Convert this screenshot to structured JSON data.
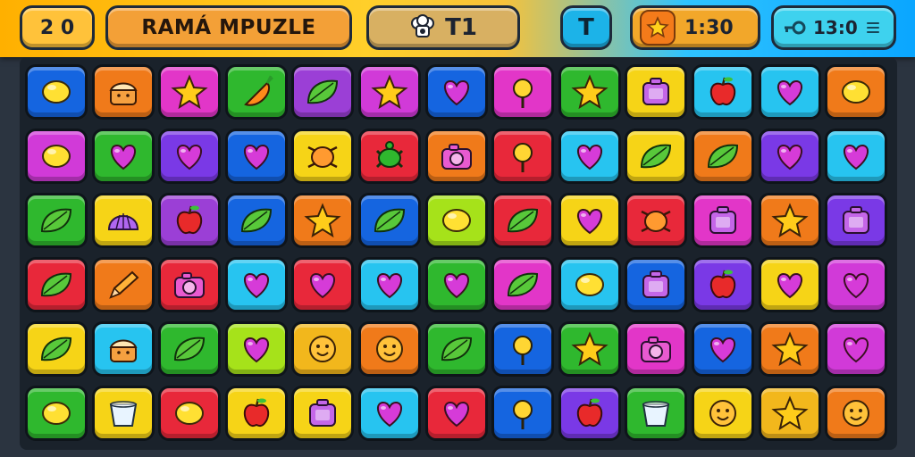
{
  "header": {
    "level_label": "2 0",
    "title": "RAMÁ MPUZLE",
    "center_label": "T1",
    "t_button_label": "T",
    "timer": "1:30",
    "score": "13:0"
  },
  "icons": {
    "level": "level-icon",
    "chef": "chef-hat-icon",
    "star": "star-icon",
    "key": "key-icon",
    "menu": "menu-icon"
  },
  "colors": {
    "blue": "#1565e0",
    "orange": "#f07a1a",
    "pink": "#e236c8",
    "green": "#2fb82e",
    "purple": "#9b3fd6",
    "magenta": "#d13ad8",
    "cyan": "#27c4f0",
    "yellow": "#f6d417",
    "red": "#e8283a",
    "lime": "#a6e21a",
    "violet": "#7a39e6",
    "gold": "#f2b71c"
  },
  "board": {
    "rows": [
      [
        {
          "bg": "blue",
          "icon": "lemon"
        },
        {
          "bg": "orange",
          "icon": "cake"
        },
        {
          "bg": "pink",
          "icon": "star"
        },
        {
          "bg": "green",
          "icon": "carrot"
        },
        {
          "bg": "purple",
          "icon": "leaf"
        },
        {
          "bg": "magenta",
          "icon": "star"
        },
        {
          "bg": "blue",
          "icon": "heart"
        },
        {
          "bg": "pink",
          "icon": "sprout"
        },
        {
          "bg": "green",
          "icon": "star"
        },
        {
          "bg": "yellow",
          "icon": "box"
        },
        {
          "bg": "cyan",
          "icon": "apple"
        },
        {
          "bg": "cyan",
          "icon": "heart"
        },
        {
          "bg": "orange",
          "icon": "lemon"
        }
      ],
      [
        {
          "bg": "magenta",
          "icon": "lemon"
        },
        {
          "bg": "green",
          "icon": "heart"
        },
        {
          "bg": "violet",
          "icon": "heart"
        },
        {
          "bg": "blue",
          "icon": "heart"
        },
        {
          "bg": "yellow",
          "icon": "bug"
        },
        {
          "bg": "red",
          "icon": "turtle"
        },
        {
          "bg": "orange",
          "icon": "camera"
        },
        {
          "bg": "red",
          "icon": "sprout"
        },
        {
          "bg": "cyan",
          "icon": "heart"
        },
        {
          "bg": "yellow",
          "icon": "leaf"
        },
        {
          "bg": "orange",
          "icon": "leaf"
        },
        {
          "bg": "violet",
          "icon": "heart"
        },
        {
          "bg": "cyan",
          "icon": "heart"
        }
      ],
      [
        {
          "bg": "green",
          "icon": "leaf"
        },
        {
          "bg": "yellow",
          "icon": "shell"
        },
        {
          "bg": "purple",
          "icon": "apple"
        },
        {
          "bg": "blue",
          "icon": "leaf"
        },
        {
          "bg": "orange",
          "icon": "star"
        },
        {
          "bg": "blue",
          "icon": "leaf"
        },
        {
          "bg": "lime",
          "icon": "lemon"
        },
        {
          "bg": "red",
          "icon": "leaf"
        },
        {
          "bg": "yellow",
          "icon": "heart"
        },
        {
          "bg": "red",
          "icon": "bug"
        },
        {
          "bg": "pink",
          "icon": "box"
        },
        {
          "bg": "orange",
          "icon": "star"
        },
        {
          "bg": "violet",
          "icon": "box"
        }
      ],
      [
        {
          "bg": "red",
          "icon": "leaf"
        },
        {
          "bg": "orange",
          "icon": "pencil"
        },
        {
          "bg": "red",
          "icon": "camera"
        },
        {
          "bg": "cyan",
          "icon": "heart"
        },
        {
          "bg": "red",
          "icon": "heart"
        },
        {
          "bg": "cyan",
          "icon": "heart"
        },
        {
          "bg": "green",
          "icon": "heart"
        },
        {
          "bg": "pink",
          "icon": "leaf"
        },
        {
          "bg": "cyan",
          "icon": "lemon"
        },
        {
          "bg": "blue",
          "icon": "box"
        },
        {
          "bg": "violet",
          "icon": "apple"
        },
        {
          "bg": "yellow",
          "icon": "heart"
        },
        {
          "bg": "magenta",
          "icon": "heart"
        }
      ],
      [
        {
          "bg": "yellow",
          "icon": "leaf"
        },
        {
          "bg": "cyan",
          "icon": "cake"
        },
        {
          "bg": "green",
          "icon": "leaf"
        },
        {
          "bg": "lime",
          "icon": "heart"
        },
        {
          "bg": "gold",
          "icon": "face"
        },
        {
          "bg": "orange",
          "icon": "face"
        },
        {
          "bg": "green",
          "icon": "leaf"
        },
        {
          "bg": "blue",
          "icon": "sprout"
        },
        {
          "bg": "green",
          "icon": "star"
        },
        {
          "bg": "pink",
          "icon": "camera"
        },
        {
          "bg": "blue",
          "icon": "heart"
        },
        {
          "bg": "orange",
          "icon": "star"
        },
        {
          "bg": "magenta",
          "icon": "heart"
        }
      ],
      [
        {
          "bg": "green",
          "icon": "lemon"
        },
        {
          "bg": "yellow",
          "icon": "cup"
        },
        {
          "bg": "red",
          "icon": "lemon"
        },
        {
          "bg": "yellow",
          "icon": "apple"
        },
        {
          "bg": "yellow",
          "icon": "box"
        },
        {
          "bg": "cyan",
          "icon": "heart"
        },
        {
          "bg": "red",
          "icon": "heart"
        },
        {
          "bg": "blue",
          "icon": "sprout"
        },
        {
          "bg": "violet",
          "icon": "apple"
        },
        {
          "bg": "green",
          "icon": "cup"
        },
        {
          "bg": "yellow",
          "icon": "face"
        },
        {
          "bg": "gold",
          "icon": "star"
        },
        {
          "bg": "orange",
          "icon": "face"
        }
      ]
    ]
  }
}
